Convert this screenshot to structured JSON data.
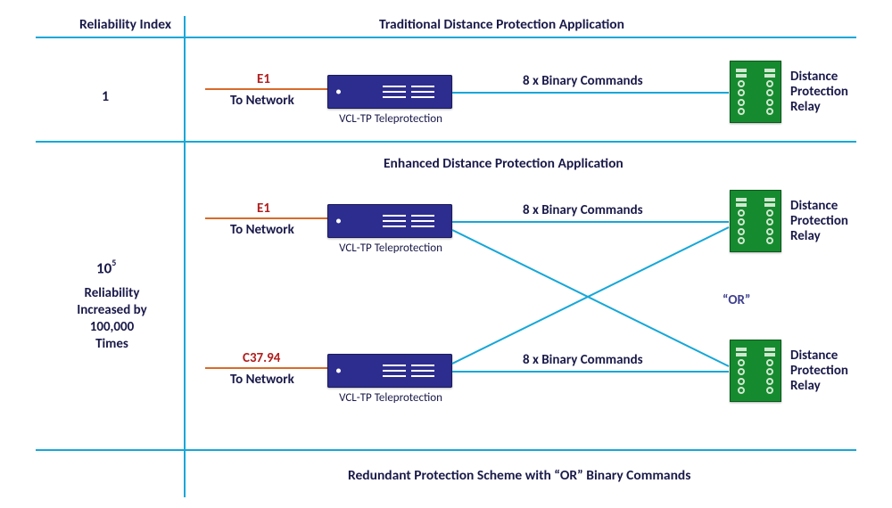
{
  "headers": {
    "reliability_index": "Reliability Index",
    "traditional": "Traditional Distance Protection Application",
    "enhanced": "Enhanced Distance Protection Application",
    "footer": "Redundant Protection Scheme with “OR” Binary Commands"
  },
  "reliability": {
    "index1": "1",
    "index2_base": "10",
    "index2_exp": "5",
    "note_line1": "Reliability",
    "note_line2": "Increased by",
    "note_line3": "100,000",
    "note_line4": "Times"
  },
  "link_labels": {
    "e1": "E1",
    "c3794": "C37.94",
    "to_network": "To Network",
    "binary8": "8 x Binary Commands",
    "or": "“OR”"
  },
  "devices": {
    "vcltp": "VCL-TP Teleprotection",
    "relay_line1": "Distance",
    "relay_line2": "Protection",
    "relay_line3": "Relay"
  }
}
